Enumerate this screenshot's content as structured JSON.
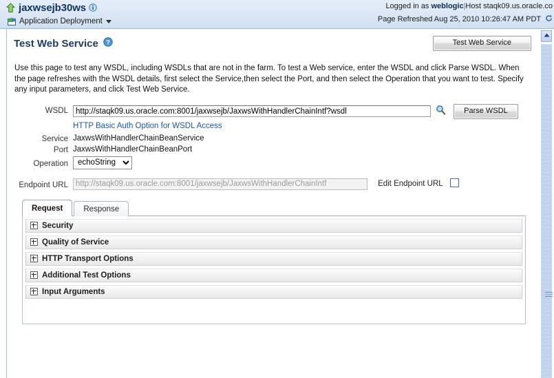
{
  "header": {
    "target_name": "jaxwsejb30ws",
    "target_type": "Application Deployment",
    "logged_in_prefix": "Logged in as",
    "user": "weblogic",
    "separator": "|",
    "host_label": "Host",
    "host": "staqk09.us.oracle.co",
    "page_refreshed": "Page Refreshed Aug 25, 2010 10:26:47 AM PDT",
    "icons": {
      "up": "up-arrow-icon",
      "info": "info-icon",
      "deployment": "application-deployment-icon",
      "refresh": "refresh-icon",
      "caret": "chevron-down-icon"
    }
  },
  "page": {
    "title": "Test Web Service",
    "help_icon": "help-icon",
    "test_button": "Test Web Service",
    "intro": "Use this page to test any WSDL, including WSDLs that are not in the farm. To test a Web service, enter the WSDL and click Parse WSDL. When the page refreshes with the WSDL details, first select the Service,then select the Port, and then select the Operation that you want to test. Specify any input parameters, and click Test Web Service."
  },
  "form": {
    "wsdl_label": "WSDL",
    "wsdl_value": "http://staqk09.us.oracle.com:8001/jaxwsejb/JaxwsWithHandlerChainIntf?wsdl",
    "wsdl_placeholder": "",
    "search_icon": "search-icon",
    "parse_button": "Parse WSDL",
    "auth_link": "HTTP Basic Auth Option for WSDL Access",
    "service_label": "Service",
    "service_value": "JaxwsWithHandlerChainBeanService",
    "port_label": "Port",
    "port_value": "JaxwsWithHandlerChainBeanPort",
    "operation_label": "Operation",
    "operation_selected": "echoString",
    "operation_options": [
      "echoString"
    ],
    "endpoint_label": "Endpoint URL",
    "endpoint_value": "http://staqk09.us.oracle.com:8001/jaxwsejb/JaxwsWithHandlerChainIntf",
    "edit_endpoint_label": "Edit Endpoint URL",
    "edit_endpoint_checked": false
  },
  "tabs": [
    {
      "label": "Request",
      "active": true
    },
    {
      "label": "Response",
      "active": false
    }
  ],
  "sections": [
    {
      "label": "Security",
      "expanded": false
    },
    {
      "label": "Quality of Service",
      "expanded": false
    },
    {
      "label": "HTTP Transport Options",
      "expanded": false
    },
    {
      "label": "Additional Test Options",
      "expanded": false
    },
    {
      "label": "Input Arguments",
      "expanded": false
    }
  ],
  "colors": {
    "header_band": "#dbe7f5",
    "title_blue": "#1f3c63",
    "link_blue": "#1c55a5",
    "scrollbar_track": "#aac4ee"
  }
}
